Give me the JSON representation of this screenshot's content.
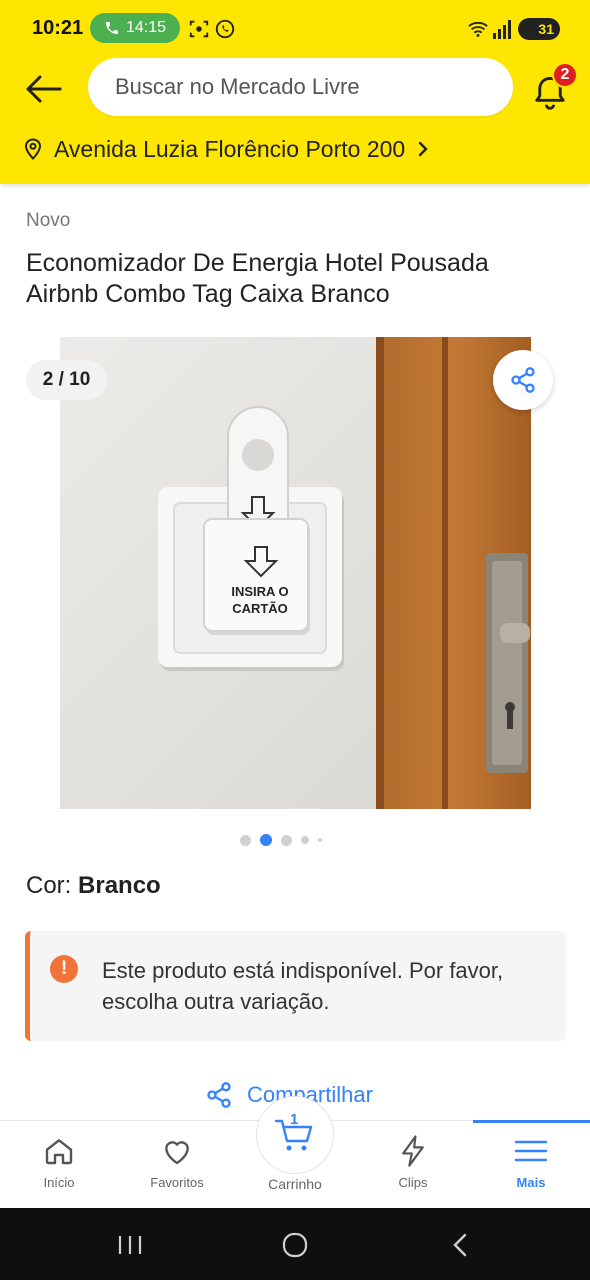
{
  "status_bar": {
    "time": "10:21",
    "call_time": "14:15",
    "battery": "31",
    "icons": [
      "phone-icon",
      "screen-record-icon",
      "whatsapp-icon",
      "wifi-icon",
      "signal-icon"
    ]
  },
  "header": {
    "search_placeholder": "Buscar no Mercado Livre",
    "notifications_count": "2",
    "address": "Avenida Luzia Florêncio Porto 200",
    "colors": {
      "brand_yellow": "#ffe600",
      "badge_red": "#e02020"
    }
  },
  "product": {
    "condition": "Novo",
    "title": "Economizador De Energia Hotel Pousada Airbnb Combo Tag Caixa Branco",
    "gallery": {
      "counter": "2 / 10",
      "current_index": 2,
      "total": 10,
      "image_label": "INSIRA O CARTÃO"
    },
    "color_label": "Cor: ",
    "color_value": "Branco",
    "alert_text": "Este produto está indisponível. Por favor, escolha outra variação.",
    "alert_color": "#f0733a",
    "share_label": "Compartilhar",
    "accent": "#3483fa"
  },
  "bottom_nav": {
    "items": [
      {
        "label": "Início",
        "icon": "home-icon"
      },
      {
        "label": "Favoritos",
        "icon": "heart-icon"
      },
      {
        "label": "Carrinho",
        "icon": "cart-icon",
        "badge": "1"
      },
      {
        "label": "Clips",
        "icon": "lightning-icon"
      },
      {
        "label": "Mais",
        "icon": "menu-icon",
        "active": true
      }
    ]
  }
}
